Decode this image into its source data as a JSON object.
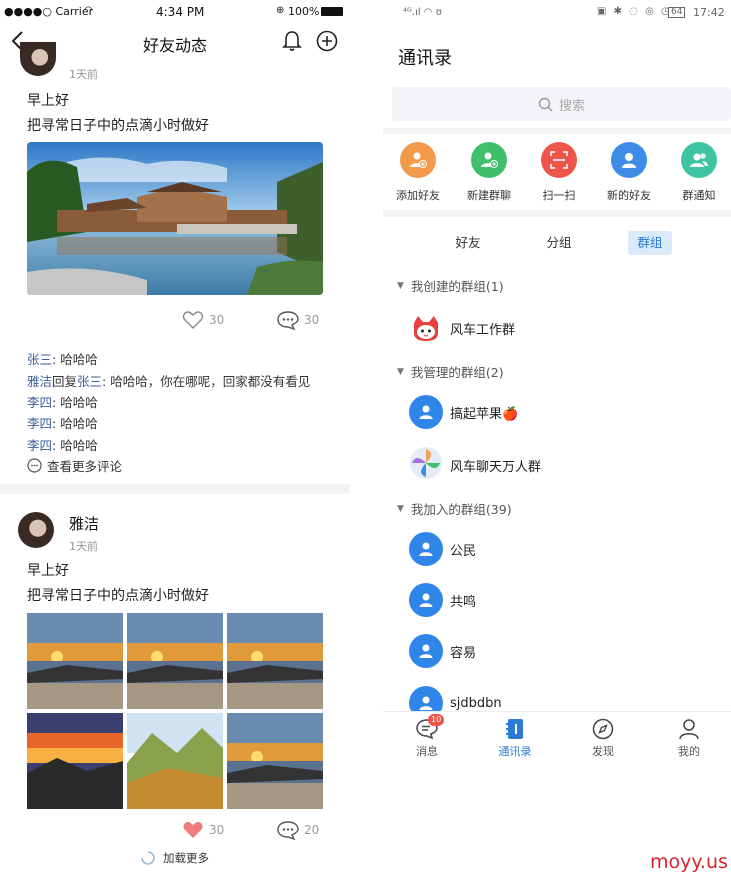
{
  "left": {
    "status": {
      "carrier": "●●●●○ Carrier",
      "time": "4:34 PM",
      "battery": "100%"
    },
    "header": {
      "title": "好友动态"
    },
    "post1": {
      "time": "1天前",
      "line1": "早上好",
      "line2": "把寻常日子中的点滴小时做好",
      "likes": "30",
      "comments": "30",
      "comment_list": [
        {
          "who": "张三",
          "text": ": 哈哈哈"
        },
        {
          "who": "雅洁",
          "mid": "回复",
          "who2": "张三",
          "text": ": 哈哈哈，你在哪呢，回家都没有看见"
        },
        {
          "who": "李四",
          "text": ": 哈哈哈"
        },
        {
          "who": "李四",
          "text": ": 哈哈哈"
        },
        {
          "who": "李四",
          "text": ": 哈哈哈"
        }
      ],
      "more_comments": "查看更多评论"
    },
    "post2": {
      "name": "雅洁",
      "time": "1天前",
      "line1": "早上好",
      "line2": "把寻常日子中的点滴小时做好",
      "likes": "30",
      "comments": "20",
      "load_more": "加载更多"
    }
  },
  "right": {
    "status": {
      "left": "⁴ᴳ.ıl ◠ ʊ",
      "time": "17:42",
      "battery": "64"
    },
    "title": "通讯录",
    "search": {
      "placeholder": "搜索"
    },
    "quick_actions": [
      {
        "label": "添加好友",
        "color": "#f09a4a"
      },
      {
        "label": "新建群聊",
        "color": "#3fbf6a"
      },
      {
        "label": "扫一扫",
        "color": "#f0554a"
      },
      {
        "label": "新的好友",
        "color": "#3f8be8"
      },
      {
        "label": "群通知",
        "color": "#3fc4a0"
      }
    ],
    "segments": [
      "好友",
      "分组",
      "群组"
    ],
    "groups": {
      "created": {
        "header": "我创建的群组(1)",
        "items": [
          "风车工作群"
        ]
      },
      "managed": {
        "header": "我管理的群组(2)",
        "items": [
          "搞起苹果🍎",
          "风车聊天万人群"
        ]
      },
      "joined": {
        "header": "我加入的群组(39)",
        "items": [
          "公民",
          "共鸣",
          "容易",
          "sjdbdbn"
        ]
      }
    },
    "tabs": [
      {
        "label": "消息",
        "badge": "10"
      },
      {
        "label": "通讯录"
      },
      {
        "label": "发现"
      },
      {
        "label": "我的"
      }
    ]
  },
  "watermark": "moyy.us",
  "colors": {
    "accent": "#2a7ad6",
    "name_link": "#3a5e9a",
    "like_red": "#f07b7b"
  }
}
